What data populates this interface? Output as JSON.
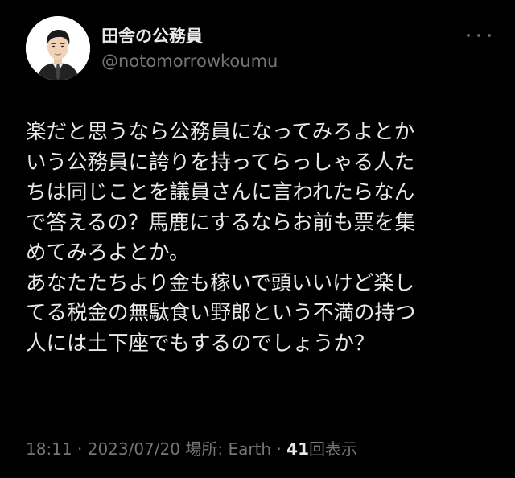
{
  "user": {
    "display_name": "田舎の公務員",
    "handle": "@notomorrowkoumu",
    "avatar_icon": "man-in-suit-avatar-icon"
  },
  "more_icon": "more-options-icon",
  "tweet": {
    "lines": [
      "楽だと思うなら公務員になってみろよとか",
      "いう公務員に誇りを持ってらっしゃる人た",
      "ちは同じことを議員さんに言われたらなん",
      "で答えるの？馬鹿にするならお前も票を集",
      "めてみろよとか。",
      "あなたたちより金も稼いで頭いいけど楽し",
      "てる税金の無駄食い野郎という不満の持つ",
      "人には土下座でもするのでしょうか？"
    ]
  },
  "meta": {
    "time": "18:11",
    "date": "2023/07/20",
    "location_label": "場所: Earth",
    "separator": "·",
    "views_count": "41",
    "views_label": "回表示"
  },
  "colors": {
    "background": "#000000",
    "primary_text": "#e7e9ea",
    "secondary_text": "#71767b"
  }
}
